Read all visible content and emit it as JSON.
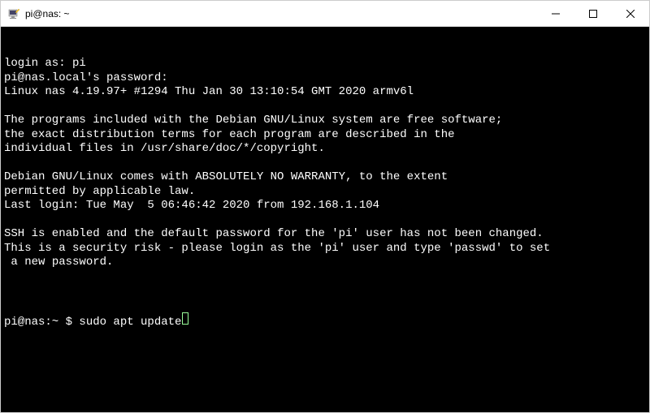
{
  "window": {
    "title": "pi@nas: ~"
  },
  "terminal": {
    "lines": [
      "login as: pi",
      "pi@nas.local's password:",
      "Linux nas 4.19.97+ #1294 Thu Jan 30 13:10:54 GMT 2020 armv6l",
      "",
      "The programs included with the Debian GNU/Linux system are free software;",
      "the exact distribution terms for each program are described in the",
      "individual files in /usr/share/doc/*/copyright.",
      "",
      "Debian GNU/Linux comes with ABSOLUTELY NO WARRANTY, to the extent",
      "permitted by applicable law.",
      "Last login: Tue May  5 06:46:42 2020 from 192.168.1.104",
      "",
      "SSH is enabled and the default password for the 'pi' user has not been changed.",
      "This is a security risk - please login as the 'pi' user and type 'passwd' to set",
      " a new password.",
      ""
    ],
    "prompt": "pi@nas:~ $ ",
    "command": "sudo apt update"
  }
}
